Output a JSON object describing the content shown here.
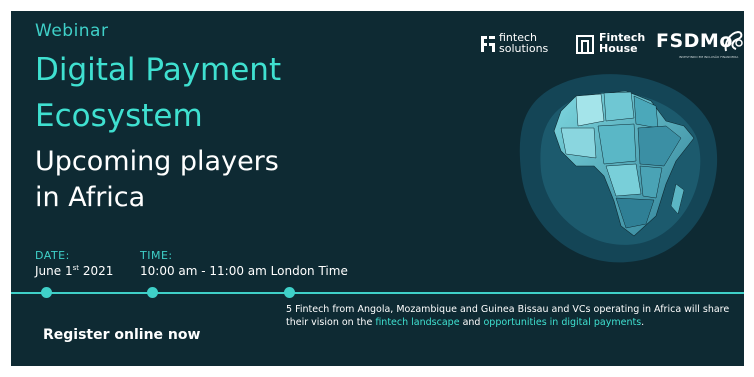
{
  "header": {
    "kicker": "Webinar",
    "title_line1": "Digital Payment",
    "title_line2": "Ecosystem",
    "subtitle_line1": "Upcoming players",
    "subtitle_line2": "in Africa"
  },
  "logos": {
    "fintech_solutions_line1": "fintech",
    "fintech_solutions_line2": "solutions",
    "fintech_house_line1": "Fintech",
    "fintech_house_line2": "House",
    "fsdmoc": "FSDMo",
    "fsdmoc_tagline": "INVESTINDO EM INCLUSÃO FINANCEIRA"
  },
  "event": {
    "date_label": "DATE:",
    "date_value": "June 1",
    "date_suffix": "st",
    "date_year": " 2021",
    "time_label": "TIME:",
    "time_value": "10:00 am - 11:00 am London Time"
  },
  "cta": {
    "register": "Register online now"
  },
  "description": {
    "part1": "5 Fintech from Angola, Mozambique and Guinea Bissau and VCs operating in Africa will share their vision on the ",
    "highlight1": "fintech landscape",
    "part2": " and ",
    "highlight2": "opportunities in digital payments",
    "part3": "."
  },
  "colors": {
    "background": "#0e2a33",
    "accent": "#3fd0c8",
    "text": "#ffffff"
  }
}
